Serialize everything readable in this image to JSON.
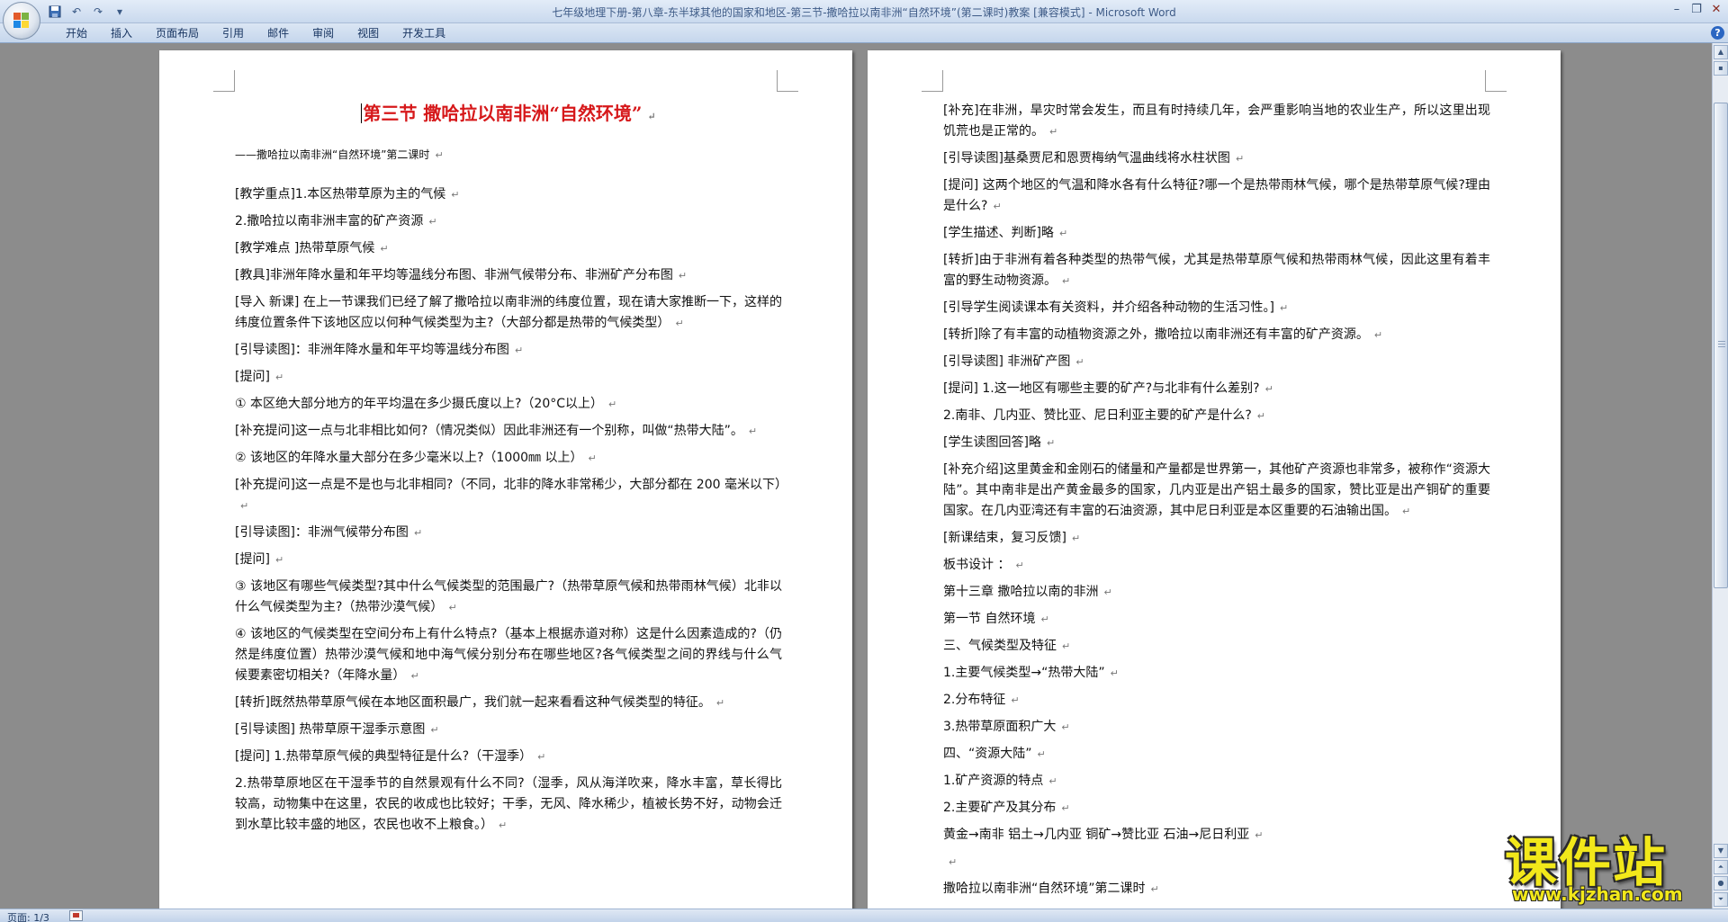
{
  "window": {
    "title": "七年级地理下册-第八章-东半球其他的国家和地区-第三节-撒哈拉以南非洲“自然环境”(第二课时)教案 [兼容模式] - Microsoft Word"
  },
  "quick_access": {
    "save_icon": "save-icon",
    "undo_icon": "undo-icon",
    "redo_icon": "redo-icon",
    "customize_icon": "dropdown-icon"
  },
  "ribbon": {
    "tabs": [
      "开始",
      "插入",
      "页面布局",
      "引用",
      "邮件",
      "审阅",
      "视图",
      "开发工具"
    ]
  },
  "status": {
    "page": "页面: 1/3"
  },
  "left_page": {
    "title": "第三节  撒哈拉以南非洲“自然环境”",
    "subtitle": "——撒哈拉以南非洲“自然环境”第二课时",
    "paragraphs": [
      "[教学重点]1.本区热带草原为主的气候",
      "2.撒哈拉以南非洲丰富的矿产资源",
      "[教学难点  ]热带草原气候",
      "[教具]非洲年降水量和年平均等温线分布图、非洲气候带分布、非洲矿产分布图",
      "[导入      新课] 在上一节课我们已经了解了撒哈拉以南非洲的纬度位置，现在请大家推断一下，这样的纬度位置条件下该地区应以何种气候类型为主?（大部分都是热带的气候类型）",
      "[引导读图]：非洲年降水量和年平均等温线分布图",
      " [提问]",
      "① 本区绝大部分地方的年平均温在多少摄氏度以上?（20°C以上）",
      "[补充提问]这一点与北非相比如何?（情况类似）因此非洲还有一个别称，叫做“热带大陆”。",
      "② 该地区的年降水量大部分在多少毫米以上?（1000㎜ 以上）",
      "[补充提问]这一点是不是也与北非相同?（不同，北非的降水非常稀少，大部分都在 200 毫米以下）",
      " [引导读图]：非洲气候带分布图",
      " [提问]",
      "③ 该地区有哪些气候类型?其中什么气候类型的范围最广?（热带草原气候和热带雨林气候）北非以什么气候类型为主?（热带沙漠气候）",
      "④ 该地区的气候类型在空间分布上有什么特点?（基本上根据赤道对称）这是什么因素造成的?（仍然是纬度位置）热带沙漠气候和地中海气候分别分布在哪些地区?各气候类型之间的界线与什么气候要素密切相关?（年降水量）",
      "[转折]既然热带草原气候在本地区面积最广，我们就一起来看看这种气候类型的特征。",
      " [引导读图] 热带草原干湿季示意图",
      " [提问] 1.热带草原气候的典型特征是什么?（干湿季）",
      "2.热带草原地区在干湿季节的自然景观有什么不同?（湿季，风从海洋吹来，降水丰富，草长得比较高，动物集中在这里，农民的收成也比较好；干季，无风、降水稀少，植被长势不好，动物会迁到水草比较丰盛的地区，农民也收不上粮食。）"
    ]
  },
  "right_page": {
    "paragraphs": [
      "[补充]在非洲，旱灾时常会发生，而且有时持续几年，会严重影响当地的农业生产，所以这里出现饥荒也是正常的。",
      "[引导读图]基桑贾尼和恩贾梅纳气温曲线将水柱状图",
      " [提问] 这两个地区的气温和降水各有什么特征?哪一个是热带雨林气候，哪个是热带草原气候?理由是什么?",
      "[学生描述、判断]略",
      "[转折]由于非洲有着各种类型的热带气候，尤其是热带草原气候和热带雨林气候，因此这里有着丰富的野生动物资源。",
      " [引导学生阅读课本有关资料，并介绍各种动物的生活习性。]",
      "[转折]除了有丰富的动植物资源之外，撒哈拉以南非洲还有丰富的矿产资源。",
      " [引导读图] 非洲矿产图",
      " [提问] 1.这一地区有哪些主要的矿产?与北非有什么差别?",
      "2.南非、几内亚、赞比亚、尼日利亚主要的矿产是什么?",
      "[学生读图回答]略",
      "[补充介绍]这里黄金和金刚石的储量和产量都是世界第一，其他矿产资源也非常多，被称作“资源大陆”。其中南非是出产黄金最多的国家，几内亚是出产铝土最多的国家，赞比亚是出产铜矿的重要国家。在几内亚湾还有丰富的石油资源，其中尼日利亚是本区重要的石油输出国。",
      "[新课结束，复习反馈]",
      "板书设计    ：",
      "第十三章  撒哈拉以南的非洲",
      "第一节  自然环境",
      "三、气候类型及特征",
      "1.主要气候类型→“热带大陆”",
      "2.分布特征",
      "3.热带草原面积广大",
      "四、“资源大陆”",
      "1.矿产资源的特点",
      "2.主要矿产及其分布",
      "黄金→南非  铝土→几内亚  铜矿→赞比亚  石油→尼日利亚",
      "",
      "撒哈拉以南非洲“自然环境”第二课时"
    ]
  },
  "watermark": {
    "text": "课件站",
    "url": "www.kjzhan.com"
  },
  "colors": {
    "title_red": "#d6181a",
    "ribbon_blue": "#c5d6ec",
    "doc_bg": "#8c8c8c"
  }
}
